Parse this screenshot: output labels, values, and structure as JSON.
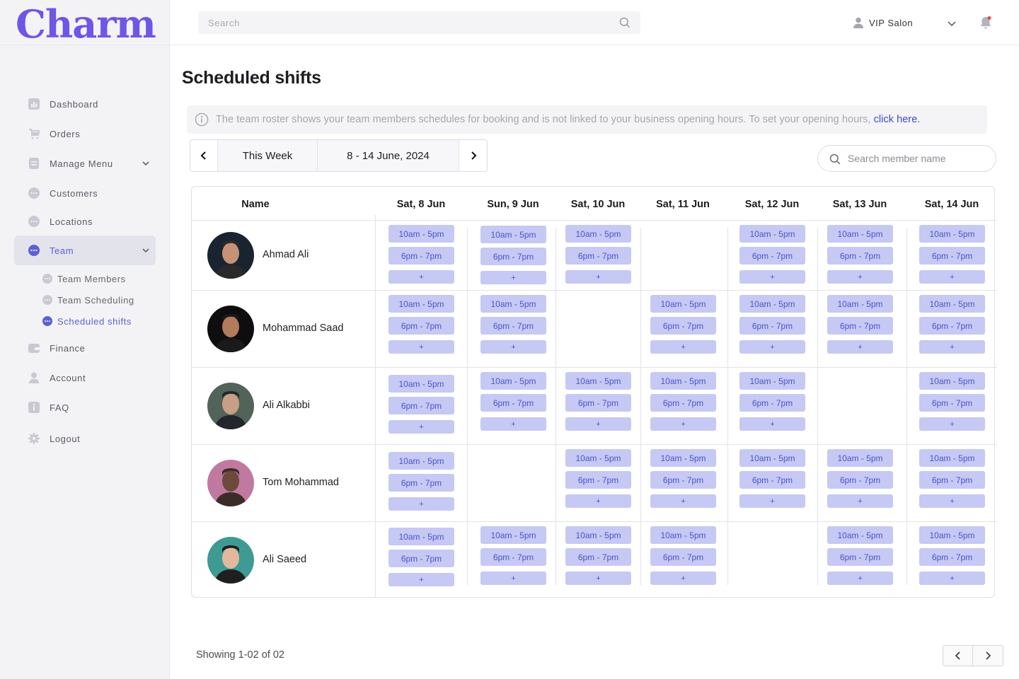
{
  "app": {
    "logo": "Charm"
  },
  "header": {
    "search_placeholder": "Search",
    "salon_name": "VIP Salon"
  },
  "colors": {
    "brand": "#6e56e6",
    "accent": "#5b61d6",
    "chip_bg": "#c6c9f3",
    "chip_text": "#4a53d0",
    "notification_dot": "#e5483b"
  },
  "sidebar": {
    "items": [
      {
        "label": "Dashboard",
        "icon": "bar-chart-icon"
      },
      {
        "label": "Orders",
        "icon": "cart-icon"
      },
      {
        "label": "Manage Menu",
        "icon": "document-icon"
      },
      {
        "label": "Customers",
        "icon": "chat-dots-icon"
      },
      {
        "label": "Locations",
        "icon": "chat-dots-icon"
      },
      {
        "label": "Team",
        "icon": "chat-dots-icon"
      },
      {
        "label": "Finance",
        "icon": "wallet-icon"
      },
      {
        "label": "Account",
        "icon": "user-icon"
      },
      {
        "label": "FAQ",
        "icon": "info-icon"
      },
      {
        "label": "Logout",
        "icon": "gear-icon"
      }
    ],
    "team_sub": [
      "Team Members",
      "Team Scheduling",
      "Scheduled shifts"
    ]
  },
  "main": {
    "title": "Scheduled shifts",
    "notice_text": "The team roster shows your team members schedules for booking and is not linked to your business opening hours. To set your opening hours,",
    "notice_link": "click here.",
    "week_label": "This Week",
    "date_range": "8 - 14 June, 2024",
    "member_search_placeholder": "Search member name"
  },
  "table": {
    "name_header": "Name",
    "days": [
      "Sat, 8 Jun",
      "Sun, 9 Jun",
      "Sat, 10 Jun",
      "Sat, 11 Jun",
      "Sat, 12 Jun",
      "Sat, 13 Jun",
      "Sat, 14 Jun"
    ],
    "shift_labels": [
      "10am - 5pm",
      "6pm - 7pm",
      "+"
    ],
    "rows": [
      {
        "name": "Ahmad Ali",
        "days": [
          true,
          true,
          true,
          false,
          true,
          true,
          true
        ]
      },
      {
        "name": "Mohammad Saad",
        "days": [
          true,
          true,
          false,
          true,
          true,
          true,
          true
        ]
      },
      {
        "name": "Ali Alkabbi",
        "days": [
          true,
          true,
          true,
          true,
          true,
          false,
          true
        ]
      },
      {
        "name": "Tom Mohammad",
        "days": [
          true,
          false,
          true,
          true,
          true,
          true,
          true
        ]
      },
      {
        "name": "Ali Saeed",
        "days": [
          true,
          true,
          true,
          true,
          false,
          true,
          true
        ]
      }
    ]
  },
  "footer": {
    "showing": "Showing 1-02 of 02"
  }
}
